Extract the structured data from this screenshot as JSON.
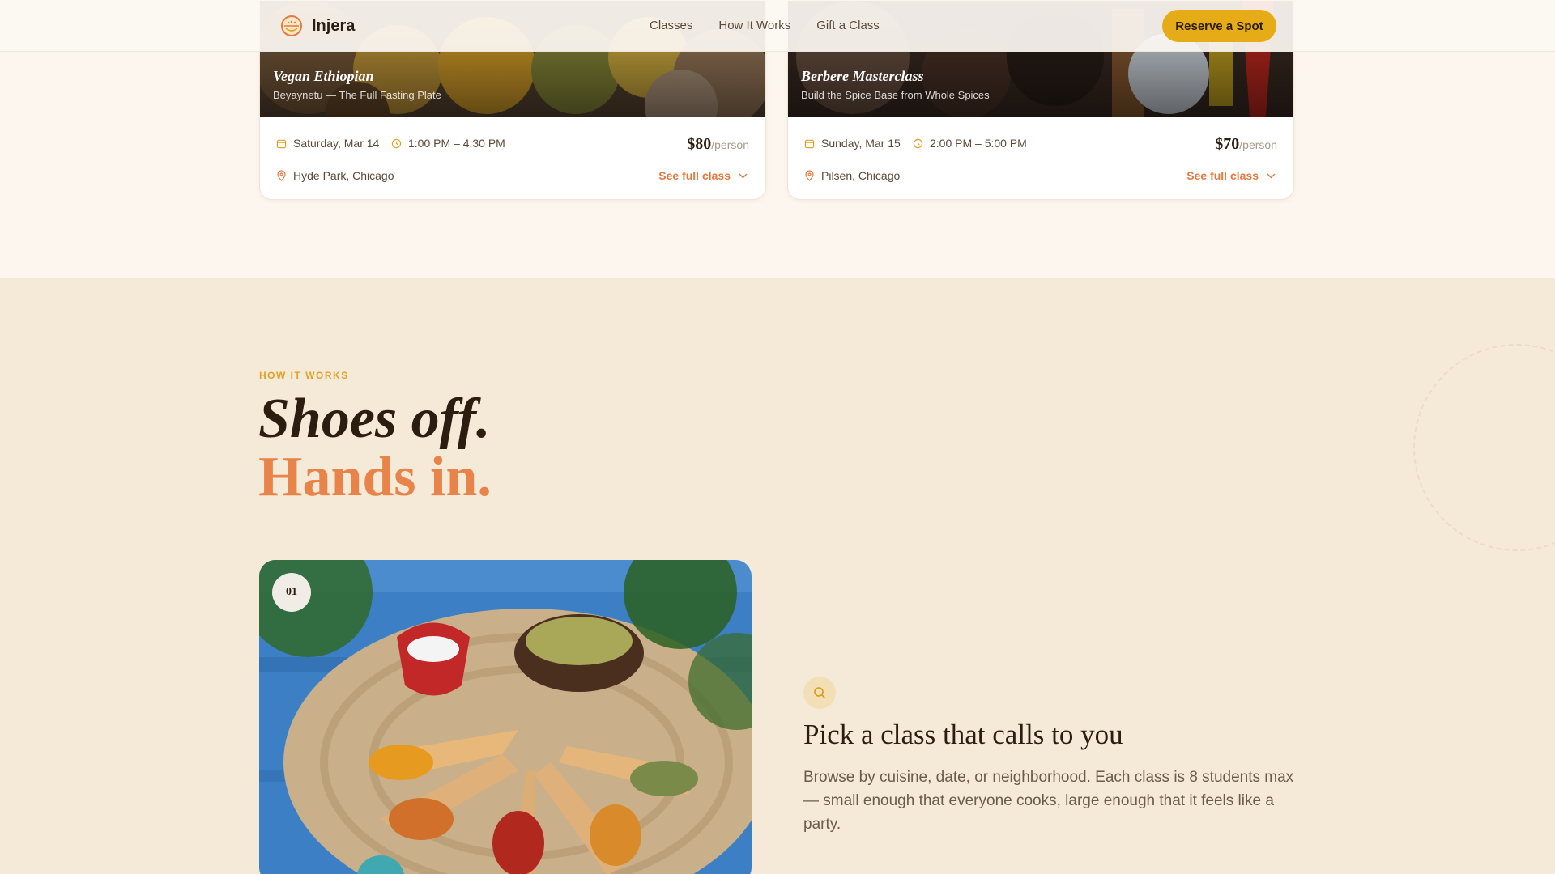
{
  "nav": {
    "brand": "Injera",
    "links": [
      "Classes",
      "How It Works",
      "Gift a Class"
    ],
    "cta": "Reserve a Spot"
  },
  "classes": [
    {
      "title": "Vegan Ethiopian",
      "subtitle": "Beyaynetu — The Full Fasting Plate",
      "date": "Saturday, Mar 14",
      "time": "1:00 PM – 4:30 PM",
      "location": "Hyde Park, Chicago",
      "price": "$80",
      "price_unit": "/person",
      "link": "See full class"
    },
    {
      "title": "Berbere Masterclass",
      "subtitle": "Build the Spice Base from Whole Spices",
      "date": "Sunday, Mar 15",
      "time": "2:00 PM – 5:00 PM",
      "location": "Pilsen, Chicago",
      "price": "$70",
      "price_unit": "/person",
      "link": "See full class"
    }
  ],
  "how": {
    "eyebrow": "HOW IT WORKS",
    "headline_1": "Shoes off.",
    "headline_2": "Hands in.",
    "step": {
      "number": "01",
      "title": "Pick a class that calls to you",
      "description": "Browse by cuisine, date, or neighborhood. Each class is 8 students max — small enough that everyone cooks, large enough that it feels like a party.",
      "icon": "search-icon"
    }
  },
  "colors": {
    "accent": "#e6ac17",
    "orange": "#e8834a",
    "link": "#e37a3f",
    "section_bg": "#f5e9d8"
  }
}
